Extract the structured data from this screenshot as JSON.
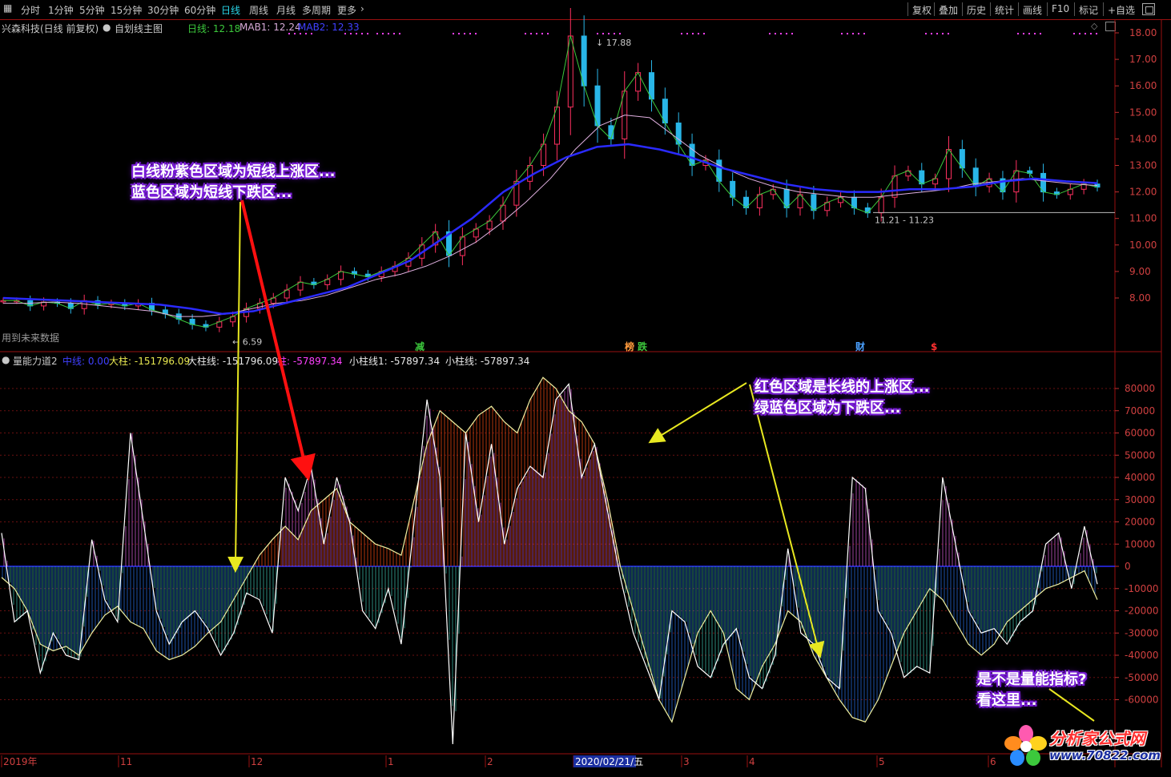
{
  "toolbar": {
    "timeframes": [
      {
        "label": "分时",
        "active": false
      },
      {
        "label": "1分钟",
        "active": false
      },
      {
        "label": "5分钟",
        "active": false
      },
      {
        "label": "15分钟",
        "active": false
      },
      {
        "label": "30分钟",
        "active": false
      },
      {
        "label": "60分钟",
        "active": false
      },
      {
        "label": "日线",
        "active": true
      },
      {
        "label": "周线",
        "active": false
      },
      {
        "label": "月线",
        "active": false
      },
      {
        "label": "多周期",
        "active": false
      },
      {
        "label": "更多",
        "active": false
      }
    ],
    "right_buttons": [
      "复权",
      "叠加",
      "历史",
      "统计",
      "画线",
      "F10",
      "标记",
      "+自选"
    ]
  },
  "price_panel": {
    "stock_title": "兴森科技(日线 前复权)",
    "template_label": "自划线主图",
    "legend": [
      {
        "label": "日线: 12.18",
        "color": "#3cc83c"
      },
      {
        "label": "MAB1: 12.24",
        "color": "#d6a9d6"
      },
      {
        "label": "MAB2: 12.33",
        "color": "#4040ff"
      }
    ],
    "future_data_note": "用到未来数据",
    "y_ticks": [
      "18.00",
      "17.00",
      "16.00",
      "15.00",
      "14.00",
      "13.00",
      "12.00",
      "11.00",
      "10.00",
      "9.00",
      "8.00"
    ],
    "high_label": "17.88",
    "low_label": "6.59",
    "range_label": "11.21 - 11.23",
    "markers": [
      {
        "text": "减",
        "color": "#3cc83c"
      },
      {
        "text": "榜",
        "color": "#ff9a3c"
      },
      {
        "text": "跌",
        "color": "#3cc83c"
      },
      {
        "text": "财",
        "color": "#4aa0ff"
      },
      {
        "text": "$",
        "color": "#ff3030"
      }
    ]
  },
  "indicator_panel": {
    "name": "量能力道2",
    "legend": [
      {
        "label": "中线: 0.00",
        "color": "#4040ff"
      },
      {
        "label": "大柱: -151796.09",
        "color": "#e8e850"
      },
      {
        "label": "大柱线: -151796.09",
        "color": "#e8e8e8"
      },
      {
        "label": "柱: -57897.34",
        "color": "#ff40ff"
      },
      {
        "label": "小柱线1: -57897.34",
        "color": "#e8e8e8"
      },
      {
        "label": "小柱线: -57897.34",
        "color": "#e8e8e8"
      }
    ],
    "y_ticks": [
      "80000",
      "70000",
      "60000",
      "50000",
      "40000",
      "30000",
      "20000",
      "10000",
      "0",
      "-10000",
      "-20000",
      "-30000",
      "-40000",
      "-50000",
      "-60000"
    ]
  },
  "date_axis": {
    "labels": [
      "2019年",
      "11",
      "12",
      "1",
      "2",
      "2020/02/21/五",
      "3",
      "4",
      "5",
      "6"
    ]
  },
  "annotations": {
    "callout1": {
      "line1": "白线粉紫色区域为短线上涨区...",
      "line2": "蓝色区域为短线下跌区..."
    },
    "callout2": {
      "line1": "红色区域是长线的上涨区...",
      "line2": "绿蓝色区域为下跌区..."
    },
    "callout3": {
      "line1": "是不是量能指标?",
      "line2": "看这里..."
    }
  },
  "watermark": {
    "name": "分析家公式网",
    "url": "www.70822.com"
  },
  "chart_data": [
    {
      "type": "candlestick",
      "title": "兴森科技(日线 前复权)",
      "ylim": [
        7.0,
        18.3
      ],
      "series": [
        {
          "name": "日线",
          "points": [
            7.9,
            7.9,
            7.7,
            7.85,
            7.8,
            7.6,
            7.9,
            7.75,
            7.8,
            7.7,
            7.8,
            7.55,
            7.4,
            7.2,
            7.0,
            6.9,
            7.1,
            7.3,
            7.6,
            7.8,
            8.0,
            8.3,
            8.6,
            8.5,
            8.7,
            9.0,
            8.9,
            8.8,
            9.0,
            9.2,
            9.5,
            10.0,
            10.5,
            9.6,
            10.3,
            10.6,
            10.9,
            11.5,
            12.4,
            13.0,
            13.8,
            15.2,
            17.88,
            16.0,
            14.5,
            14.0,
            15.8,
            16.5,
            15.5,
            14.6,
            13.8,
            13.0,
            13.2,
            12.4,
            11.8,
            11.4,
            11.9,
            12.1,
            11.4,
            11.9,
            11.3,
            11.6,
            11.8,
            11.4,
            11.21,
            11.8,
            12.6,
            12.8,
            12.3,
            12.5,
            13.6,
            12.9,
            12.2,
            12.5,
            12.0,
            12.8,
            12.7,
            12.0,
            11.9,
            12.1,
            12.3,
            12.18
          ]
        },
        {
          "name": "MAB1",
          "points": [
            7.8,
            7.8,
            7.85,
            7.8,
            7.7,
            7.6,
            7.5,
            7.3,
            7.3,
            7.4,
            7.6,
            7.8,
            7.9,
            8.1,
            8.4,
            8.7,
            8.9,
            9.2,
            9.6,
            10.1,
            10.8,
            11.6,
            12.5,
            13.6,
            14.5,
            14.9,
            14.8,
            14.1,
            13.4,
            12.9,
            12.5,
            12.2,
            12.0,
            11.9,
            11.8,
            11.8,
            11.9,
            12.0,
            12.1,
            12.3,
            12.4,
            12.5,
            12.4,
            12.3,
            12.24
          ]
        },
        {
          "name": "MAB2",
          "points": [
            8.0,
            7.95,
            7.9,
            7.85,
            7.8,
            7.75,
            7.6,
            7.4,
            7.5,
            7.8,
            8.1,
            8.4,
            8.9,
            9.4,
            10.2,
            11.0,
            12.0,
            12.7,
            13.3,
            13.7,
            13.8,
            13.6,
            13.3,
            12.9,
            12.6,
            12.3,
            12.1,
            12.0,
            12.0,
            12.1,
            12.1,
            12.2,
            12.4,
            12.5,
            12.4,
            12.33
          ]
        }
      ]
    },
    {
      "type": "area",
      "title": "量能力道2",
      "ylim": [
        -80000,
        88000
      ],
      "series": [
        {
          "name": "大柱线",
          "points": [
            -5000,
            -10000,
            -20000,
            -35000,
            -38000,
            -36000,
            -40000,
            -30000,
            -22000,
            -18000,
            -25000,
            -28000,
            -38000,
            -42000,
            -40000,
            -36000,
            -30000,
            -25000,
            -15000,
            -5000,
            5000,
            12000,
            18000,
            12000,
            25000,
            30000,
            35000,
            20000,
            15000,
            10000,
            8000,
            5000,
            30000,
            55000,
            70000,
            65000,
            60000,
            68000,
            72000,
            65000,
            60000,
            75000,
            85000,
            80000,
            70000,
            65000,
            55000,
            30000,
            0,
            -20000,
            -40000,
            -60000,
            -70000,
            -50000,
            -30000,
            -20000,
            -30000,
            -55000,
            -60000,
            -45000,
            -35000,
            -20000,
            -25000,
            -40000,
            -50000,
            -60000,
            -68000,
            -70000,
            -60000,
            -45000,
            -30000,
            -20000,
            -10000,
            -15000,
            -25000,
            -35000,
            -40000,
            -35000,
            -25000,
            -20000,
            -15000,
            -10000,
            -8000,
            -5000,
            -2000,
            -15000
          ]
        },
        {
          "name": "小柱线",
          "points": [
            15000,
            -25000,
            -20000,
            -48000,
            -30000,
            -40000,
            -42000,
            12000,
            -15000,
            -25000,
            60000,
            20000,
            -20000,
            -35000,
            -25000,
            -20000,
            -28000,
            -40000,
            -30000,
            -12000,
            -15000,
            -30000,
            40000,
            25000,
            45000,
            10000,
            40000,
            20000,
            -20000,
            -28000,
            -10000,
            -35000,
            20000,
            75000,
            40000,
            -80000,
            60000,
            20000,
            55000,
            10000,
            35000,
            45000,
            40000,
            75000,
            82000,
            40000,
            55000,
            25000,
            -5000,
            -30000,
            -45000,
            -60000,
            -20000,
            -25000,
            -45000,
            -50000,
            -35000,
            -28000,
            -50000,
            -55000,
            -40000,
            8000,
            -30000,
            -35000,
            -50000,
            -55000,
            40000,
            35000,
            -20000,
            -30000,
            -50000,
            -45000,
            -48000,
            40000,
            10000,
            -20000,
            -30000,
            -28000,
            -35000,
            -25000,
            -20000,
            10000,
            15000,
            -10000,
            18000,
            -8000
          ]
        }
      ]
    }
  ]
}
